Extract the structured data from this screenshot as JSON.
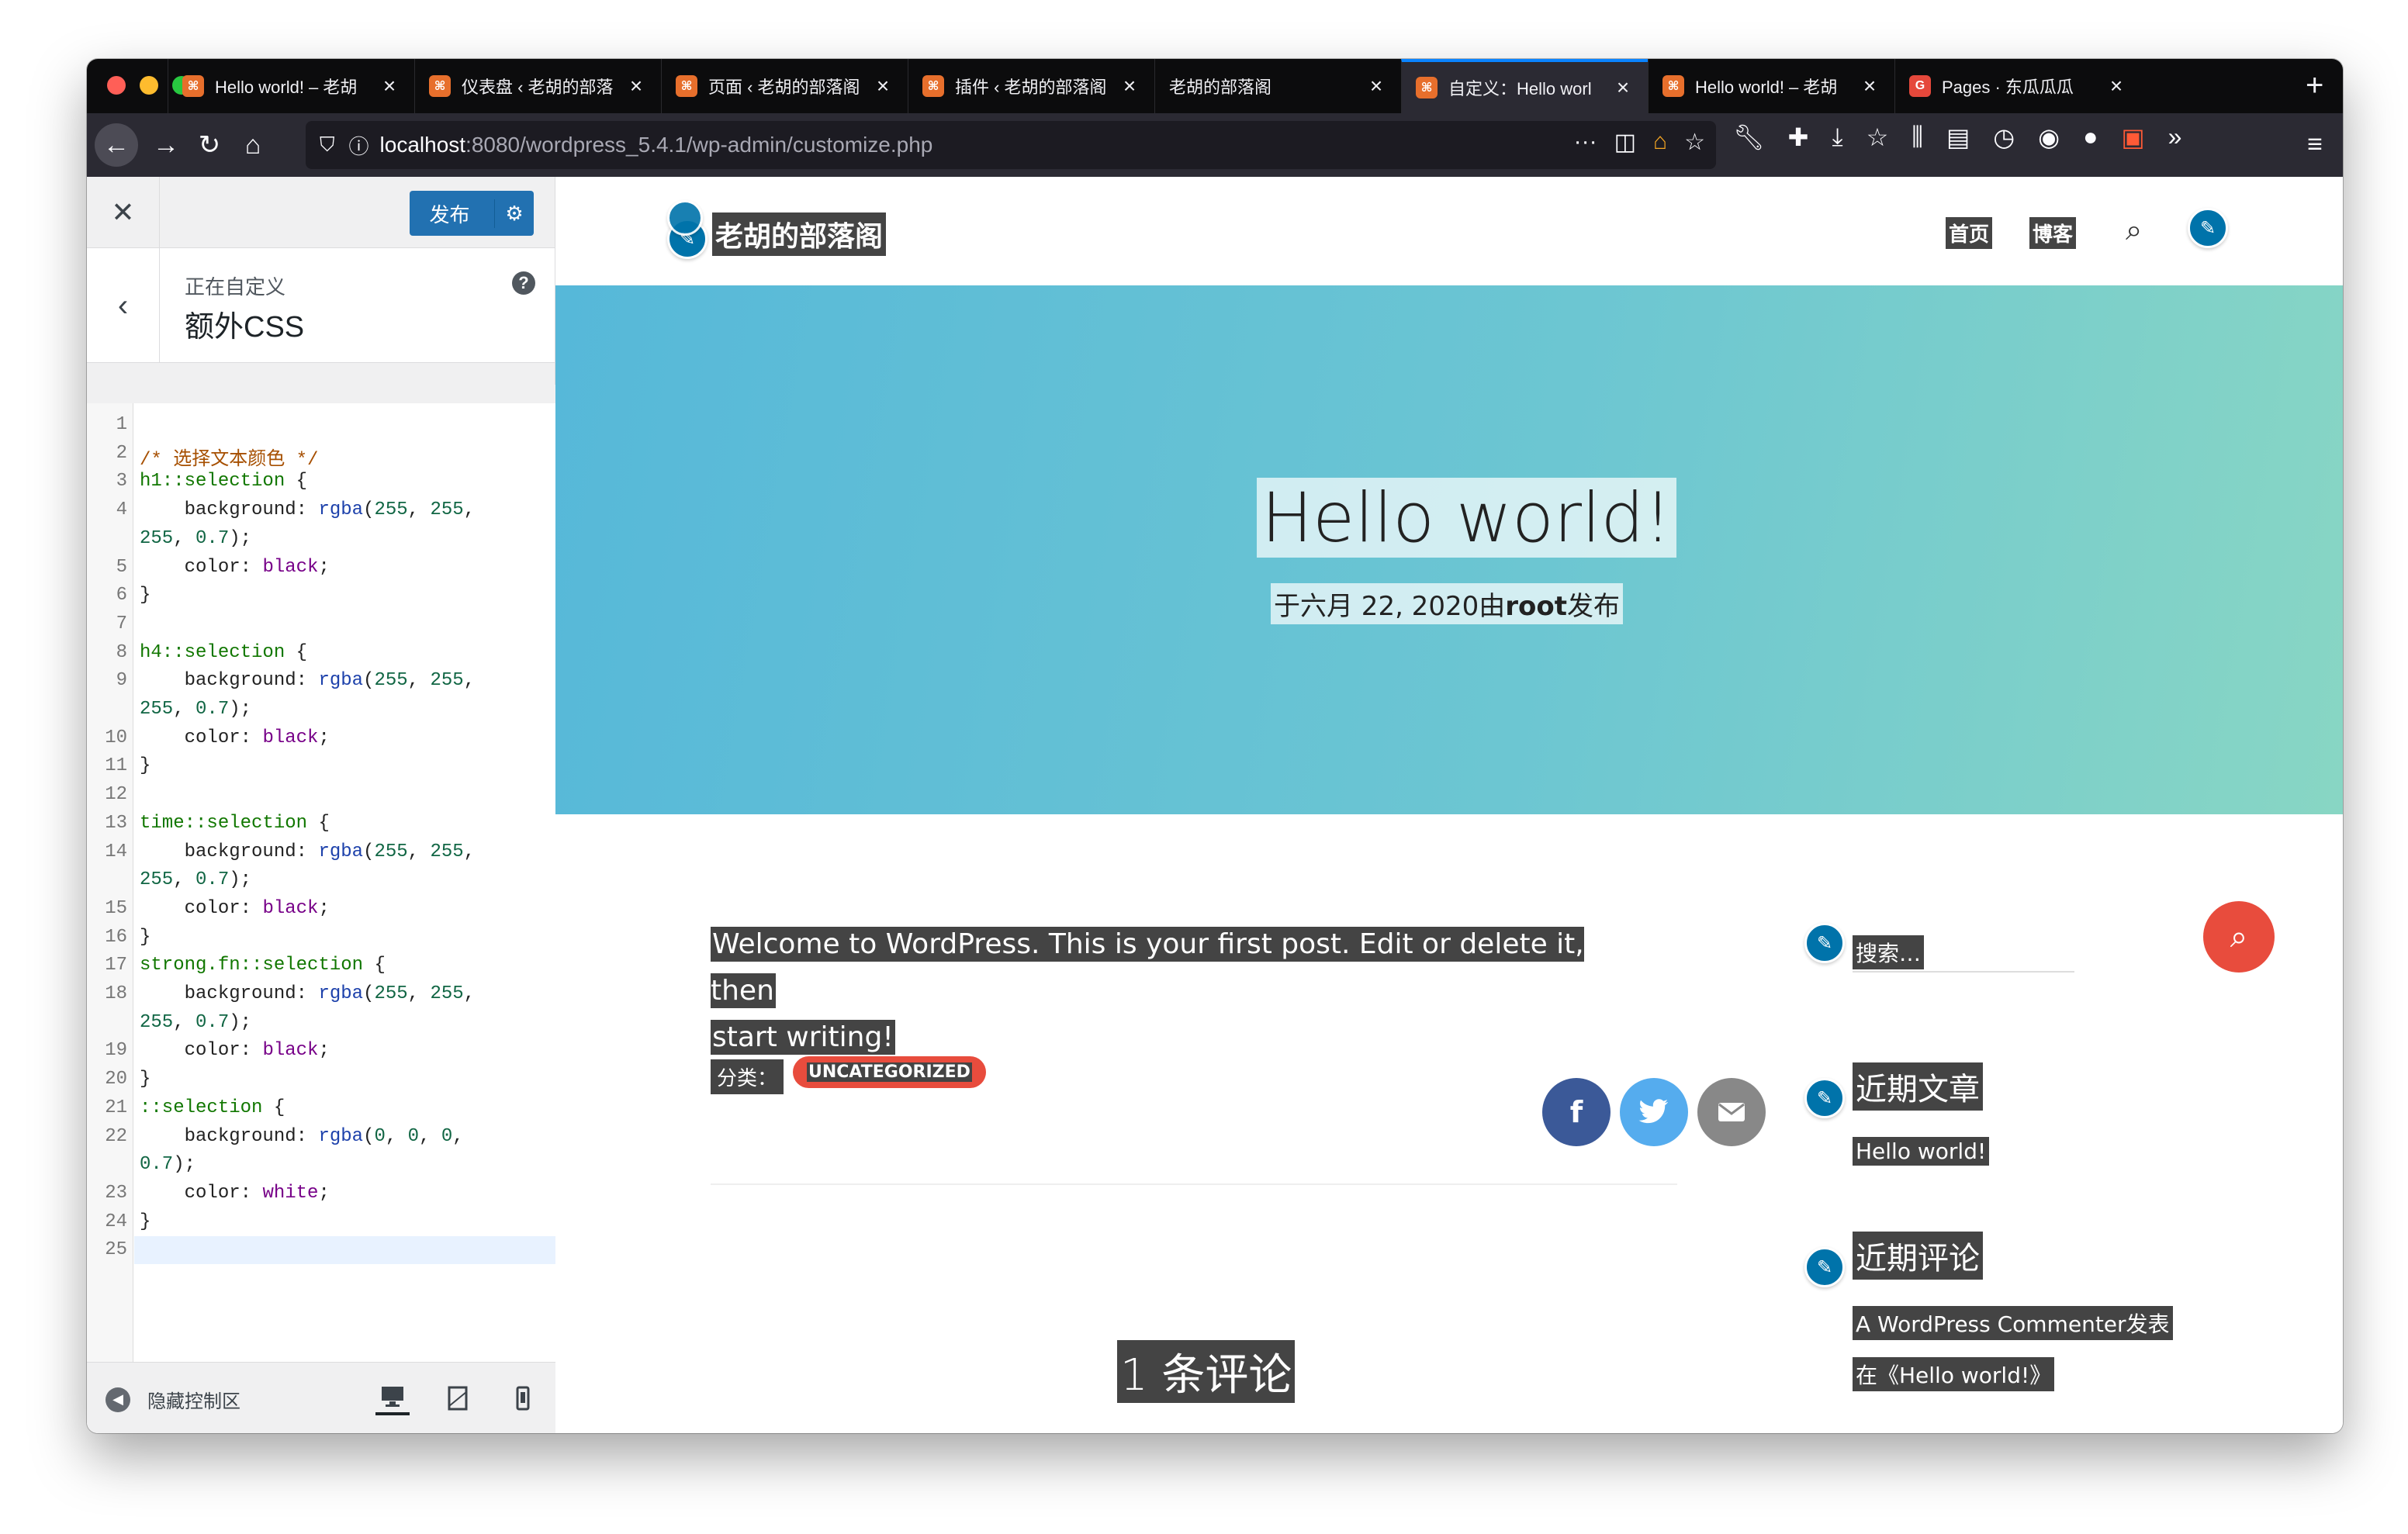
{
  "browser": {
    "tabs": [
      {
        "label": "Hello world! – 老胡",
        "icon": "xampp-icon"
      },
      {
        "label": "仪表盘 ‹ 老胡的部落",
        "icon": "xampp-icon"
      },
      {
        "label": "页面 ‹ 老胡的部落阁",
        "icon": "xampp-icon"
      },
      {
        "label": "插件 ‹ 老胡的部落阁",
        "icon": "xampp-icon"
      },
      {
        "label": "老胡的部落阁",
        "icon": ""
      },
      {
        "label": "自定义：Hello worl",
        "icon": "xampp-icon",
        "active": true
      },
      {
        "label": "Hello world! – 老胡",
        "icon": "xampp-icon"
      },
      {
        "label": "Pages · 东瓜瓜瓜",
        "icon": "gitee-icon"
      }
    ],
    "url_host": "localhost",
    "url_path": ":8080/wordpress_5.4.1/wp-admin/customize.php",
    "accent": "#0a84ff"
  },
  "customizer": {
    "publish_label": "发布",
    "customizing_label": "正在自定义",
    "section_title": "额外CSS",
    "hide_controls_label": "隐藏控制区",
    "accent": "#2271b1",
    "code_lines": [
      {
        "n": "1",
        "text": ""
      },
      {
        "n": "2",
        "text": "/* 选择文本颜色 */"
      },
      {
        "n": "3",
        "text": "h1::selection {"
      },
      {
        "n": "4",
        "text": "    background: rgba(255, 255,"
      },
      {
        "n": "",
        "text": "255, 0.7);"
      },
      {
        "n": "5",
        "text": "    color: black;"
      },
      {
        "n": "6",
        "text": "}"
      },
      {
        "n": "7",
        "text": ""
      },
      {
        "n": "8",
        "text": "h4::selection {"
      },
      {
        "n": "9",
        "text": "    background: rgba(255, 255,"
      },
      {
        "n": "",
        "text": "255, 0.7);"
      },
      {
        "n": "10",
        "text": "    color: black;"
      },
      {
        "n": "11",
        "text": "}"
      },
      {
        "n": "12",
        "text": ""
      },
      {
        "n": "13",
        "text": "time::selection {"
      },
      {
        "n": "14",
        "text": "    background: rgba(255, 255,"
      },
      {
        "n": "",
        "text": "255, 0.7);"
      },
      {
        "n": "15",
        "text": "    color: black;"
      },
      {
        "n": "16",
        "text": "}"
      },
      {
        "n": "17",
        "text": "strong.fn::selection {"
      },
      {
        "n": "18",
        "text": "    background: rgba(255, 255,"
      },
      {
        "n": "",
        "text": "255, 0.7);"
      },
      {
        "n": "19",
        "text": "    color: black;"
      },
      {
        "n": "20",
        "text": "}"
      },
      {
        "n": "21",
        "text": "::selection {"
      },
      {
        "n": "22",
        "text": "    background: rgba(0, 0, 0,"
      },
      {
        "n": "",
        "text": "0.7);"
      },
      {
        "n": "23",
        "text": "    color: white;"
      },
      {
        "n": "24",
        "text": "}"
      },
      {
        "n": "25",
        "text": ""
      }
    ]
  },
  "site": {
    "title": "老胡的部落阁",
    "menu": [
      "首页",
      "博客"
    ],
    "post_title": "Hello world!",
    "meta_prefix": "于六月 22, 2020由",
    "meta_author": "root",
    "meta_suffix": "发布",
    "excerpt_line1": "Welcome to WordPress. This is your first post. Edit or delete it, then",
    "excerpt_line2": "start writing!",
    "category_label": "分类：",
    "category": "UNCATEGORIZED",
    "comments_heading": "1 条评论",
    "search_placeholder": "搜索…",
    "recent_posts_title": "近期文章",
    "recent_post": "Hello world!",
    "recent_comments_title": "近期评论",
    "recent_comment_line1": "A WordPress Commenter发表",
    "recent_comment_line2": "在《Hello world!》",
    "hero_gradient": [
      "#56b8d9",
      "#88d6c4"
    ],
    "accent_red": "#e84c3d",
    "facebook_color": "#3b5998",
    "twitter_color": "#55acee",
    "email_color": "#888888"
  }
}
